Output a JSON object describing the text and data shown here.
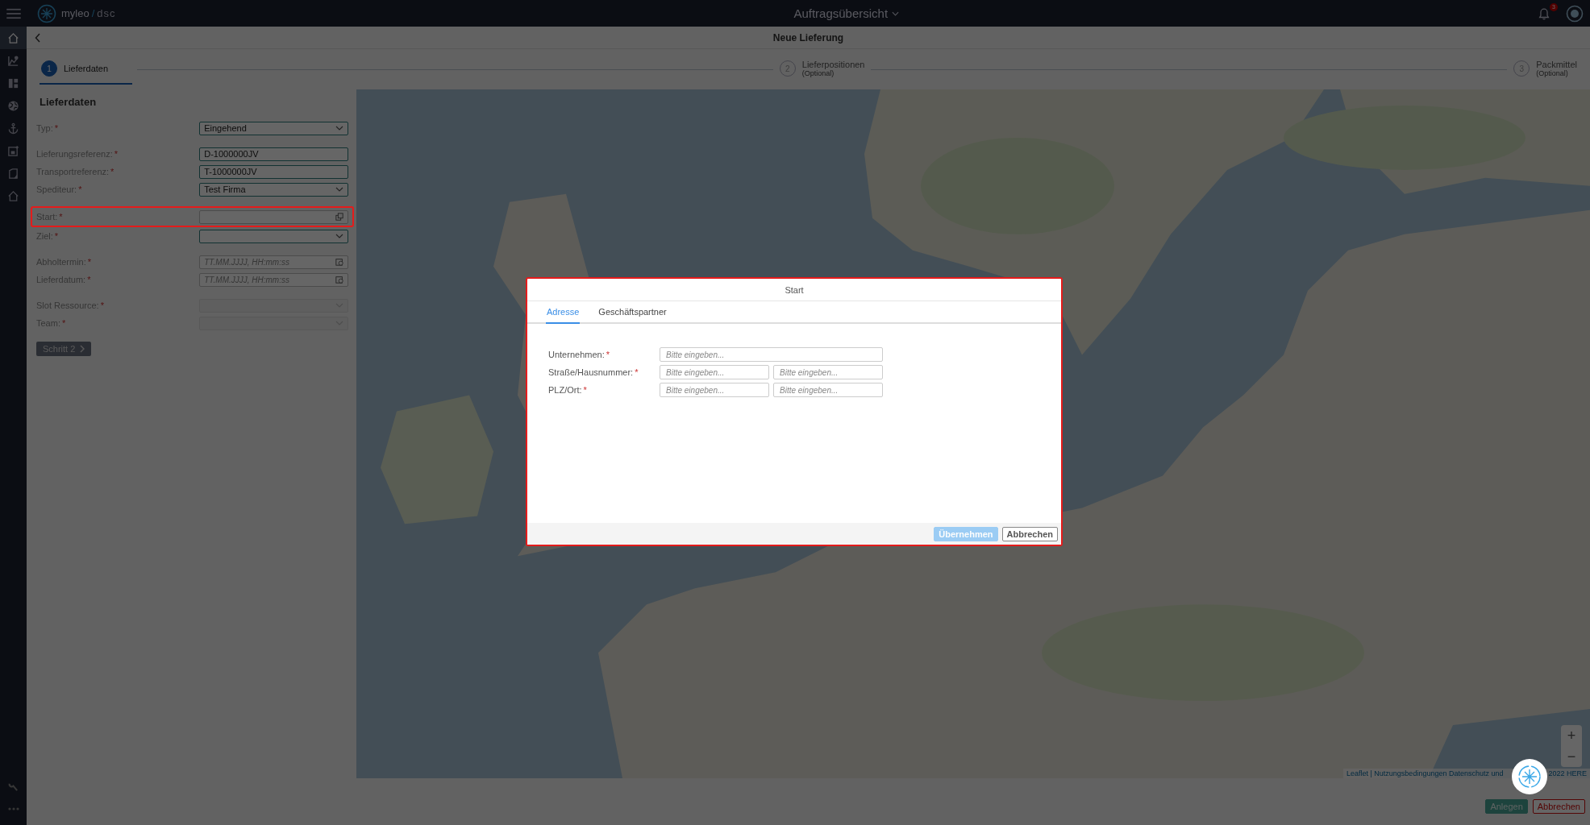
{
  "topbar": {
    "brand": "myleo",
    "separator": "/",
    "product": "dsc",
    "title": "Auftragsübersicht",
    "notifications": "3"
  },
  "sidebar": {
    "items": [
      {
        "kind": "home",
        "selected": true
      },
      {
        "kind": "chart",
        "selected": false
      },
      {
        "kind": "dashboard",
        "selected": false
      },
      {
        "kind": "globe",
        "selected": false
      },
      {
        "kind": "anchor",
        "selected": false
      },
      {
        "kind": "calendar",
        "selected": false
      },
      {
        "kind": "document",
        "selected": false
      },
      {
        "kind": "home",
        "selected": false
      }
    ],
    "bottom_items": [
      {
        "kind": "wrench",
        "selected": false
      },
      {
        "kind": "more",
        "selected": false
      }
    ]
  },
  "page": {
    "title": "Neue Lieferung"
  },
  "stepper": [
    {
      "number": "1",
      "label": "Lieferdaten",
      "selected": true
    },
    {
      "number": "2",
      "label": "Lieferpositionen",
      "note": "(Optional)",
      "selected": false
    },
    {
      "number": "3",
      "label": "Packmittel",
      "note": "(Optional)",
      "selected": false
    }
  ],
  "form": {
    "title": "Lieferdaten",
    "groups": [
      [
        {
          "label": "Typ:",
          "required_mark": "*",
          "kind": "select",
          "value": "Eingehend",
          "disabled": false,
          "highlighted": false
        }
      ],
      [
        {
          "label": "Lieferungsreferenz:",
          "required_mark": "*",
          "kind": "text",
          "value": "D-1000000JV",
          "disabled": false,
          "highlighted": false
        },
        {
          "label": "Transportreferenz:",
          "required_mark": "*",
          "kind": "text",
          "value": "T-1000000JV",
          "disabled": false,
          "highlighted": false
        },
        {
          "label": "Spediteur:",
          "required_mark": "*",
          "kind": "select",
          "value": "Test Firma",
          "disabled": false,
          "highlighted": false
        }
      ],
      [
        {
          "label": "Start:",
          "required_mark": "*",
          "kind": "picker",
          "disabled": false,
          "highlighted": true
        },
        {
          "label": "Ziel:",
          "required_mark": "*",
          "kind": "select",
          "disabled": false,
          "highlighted": false
        }
      ],
      [
        {
          "label": "Abholtermin:",
          "required_mark": "*",
          "kind": "date",
          "placeholder": "TT.MM.JJJJ, HH:mm:ss",
          "disabled": false,
          "highlighted": false
        },
        {
          "label": "Lieferdatum:",
          "required_mark": "*",
          "kind": "date",
          "placeholder": "TT.MM.JJJJ, HH:mm:ss",
          "disabled": false,
          "highlighted": false
        }
      ],
      [
        {
          "label": "Slot Ressource:",
          "required_mark": "*",
          "kind": "select",
          "disabled": true,
          "highlighted": false
        },
        {
          "label": "Team:",
          "required_mark": "*",
          "kind": "select",
          "disabled": true,
          "highlighted": false
        }
      ]
    ],
    "next_button": "Schritt 2"
  },
  "map": {
    "attribution": "Leaflet | Nutzungsbedingungen Datenschutz und",
    "attribution_end": "2022 HERE",
    "zoom_in": "+",
    "zoom_out": "−"
  },
  "footer": {
    "buttons": [
      {
        "label": "Anlegen",
        "kind": "primary"
      },
      {
        "label": "Abbrechen",
        "kind": "danger"
      }
    ]
  },
  "dialog": {
    "title": "Start",
    "tabs": [
      {
        "label": "Adresse",
        "selected": true
      },
      {
        "label": "Geschäftspartner",
        "selected": false
      }
    ],
    "rows": [
      {
        "label": "Unternehmen:",
        "required_mark": "*",
        "fields": [
          {
            "placeholder": "Bitte eingeben..."
          }
        ]
      },
      {
        "label": "Straße/Hausnummer:",
        "required_mark": "*",
        "fields": [
          {
            "placeholder": "Bitte eingeben..."
          },
          {
            "placeholder": "Bitte eingeben..."
          }
        ]
      },
      {
        "label": "PLZ/Ort:",
        "required_mark": "*",
        "fields": [
          {
            "placeholder": "Bitte eingeben..."
          },
          {
            "placeholder": "Bitte eingeben..."
          }
        ]
      }
    ],
    "buttons": [
      {
        "label": "Übernehmen",
        "kind": "primary",
        "disabled": true
      },
      {
        "label": "Abbrechen",
        "kind": "secondary",
        "disabled": false
      }
    ]
  }
}
